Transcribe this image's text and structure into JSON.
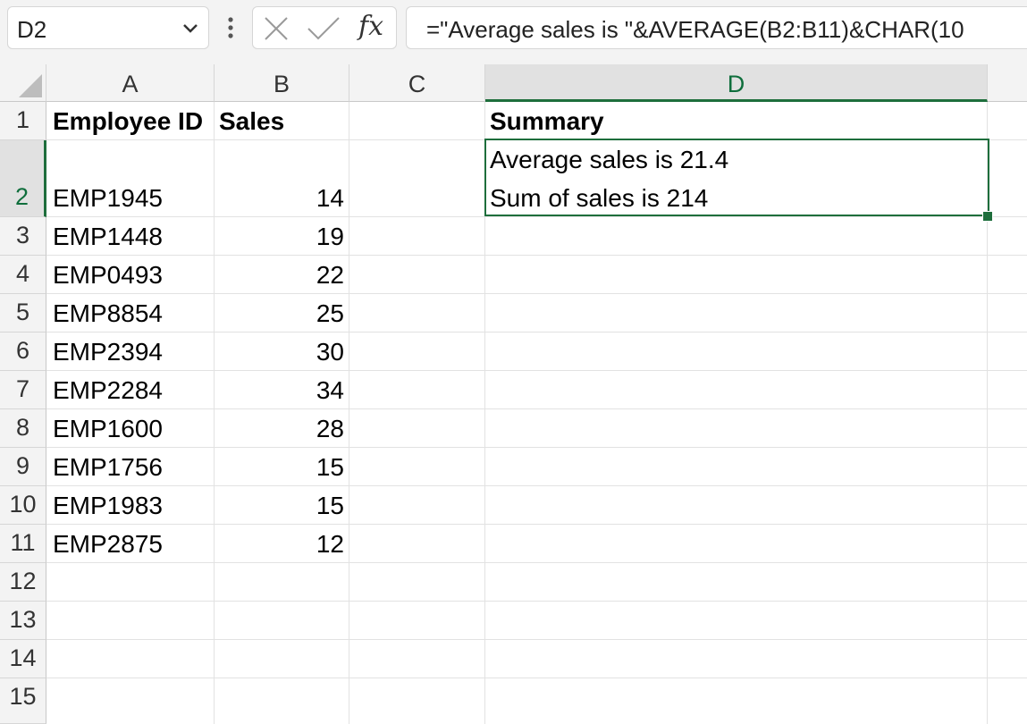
{
  "name_box": {
    "value": "D2"
  },
  "formula_bar": {
    "cancel_icon": "close-icon",
    "enter_icon": "check-icon",
    "fx_label": "fx",
    "formula": "=\"Average sales is \"&AVERAGE(B2:B11)&CHAR(10"
  },
  "columns": [
    "A",
    "B",
    "C",
    "D"
  ],
  "selected_column": "D",
  "row_numbers": [
    "1",
    "2",
    "3",
    "4",
    "5",
    "6",
    "7",
    "8",
    "9",
    "10",
    "11",
    "12",
    "13",
    "14",
    "15"
  ],
  "selected_row": "2",
  "sheet": {
    "header": {
      "a": "Employee ID",
      "b": "Sales",
      "d": "Summary"
    },
    "rows": [
      {
        "a": "EMP1945",
        "b": "14"
      },
      {
        "a": "EMP1448",
        "b": "19"
      },
      {
        "a": "EMP0493",
        "b": "22"
      },
      {
        "a": "EMP8854",
        "b": "25"
      },
      {
        "a": "EMP2394",
        "b": "30"
      },
      {
        "a": "EMP2284",
        "b": "34"
      },
      {
        "a": "EMP1600",
        "b": "28"
      },
      {
        "a": "EMP1756",
        "b": "15"
      },
      {
        "a": "EMP1983",
        "b": "15"
      },
      {
        "a": "EMP2875",
        "b": "12"
      }
    ],
    "summary": {
      "line1": "Average sales is 21.4",
      "line2": "Sum of sales is 214"
    }
  },
  "colors": {
    "accent": "#1e6e3c",
    "header_bg": "#f3f3f3",
    "selected_header_bg": "#e1e1e1",
    "gridline": "#e2e2e2"
  }
}
